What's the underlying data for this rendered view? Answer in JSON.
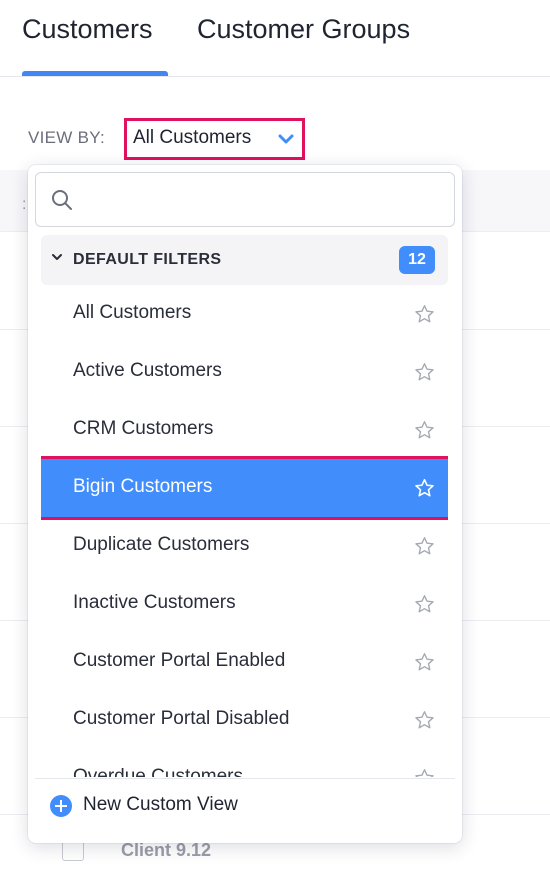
{
  "tabs": [
    {
      "label": "Customers",
      "active": true
    },
    {
      "label": "Customer Groups",
      "active": false
    }
  ],
  "view_by": {
    "label": "VIEW BY:",
    "selected": "All Customers"
  },
  "dropdown": {
    "search_placeholder": "",
    "group": {
      "title": "DEFAULT FILTERS",
      "count": "12"
    },
    "items": [
      {
        "label": "All Customers"
      },
      {
        "label": "Active Customers"
      },
      {
        "label": "CRM Customers"
      },
      {
        "label": "Bigin Customers",
        "active": true
      },
      {
        "label": "Duplicate Customers"
      },
      {
        "label": "Inactive Customers"
      },
      {
        "label": "Customer Portal Enabled"
      },
      {
        "label": "Customer Portal Disabled"
      },
      {
        "label": "Overdue Customers"
      }
    ],
    "new_view_label": "New Custom View"
  },
  "background": {
    "row_label": "Client 9.12",
    "stub": ":"
  },
  "colors": {
    "accent": "#408dfb",
    "highlight_border": "#e0115f"
  },
  "icons": {
    "search": "search-icon",
    "chevron": "chevron-down-icon",
    "star": "star-outline-icon",
    "plus": "plus-circle-icon"
  }
}
